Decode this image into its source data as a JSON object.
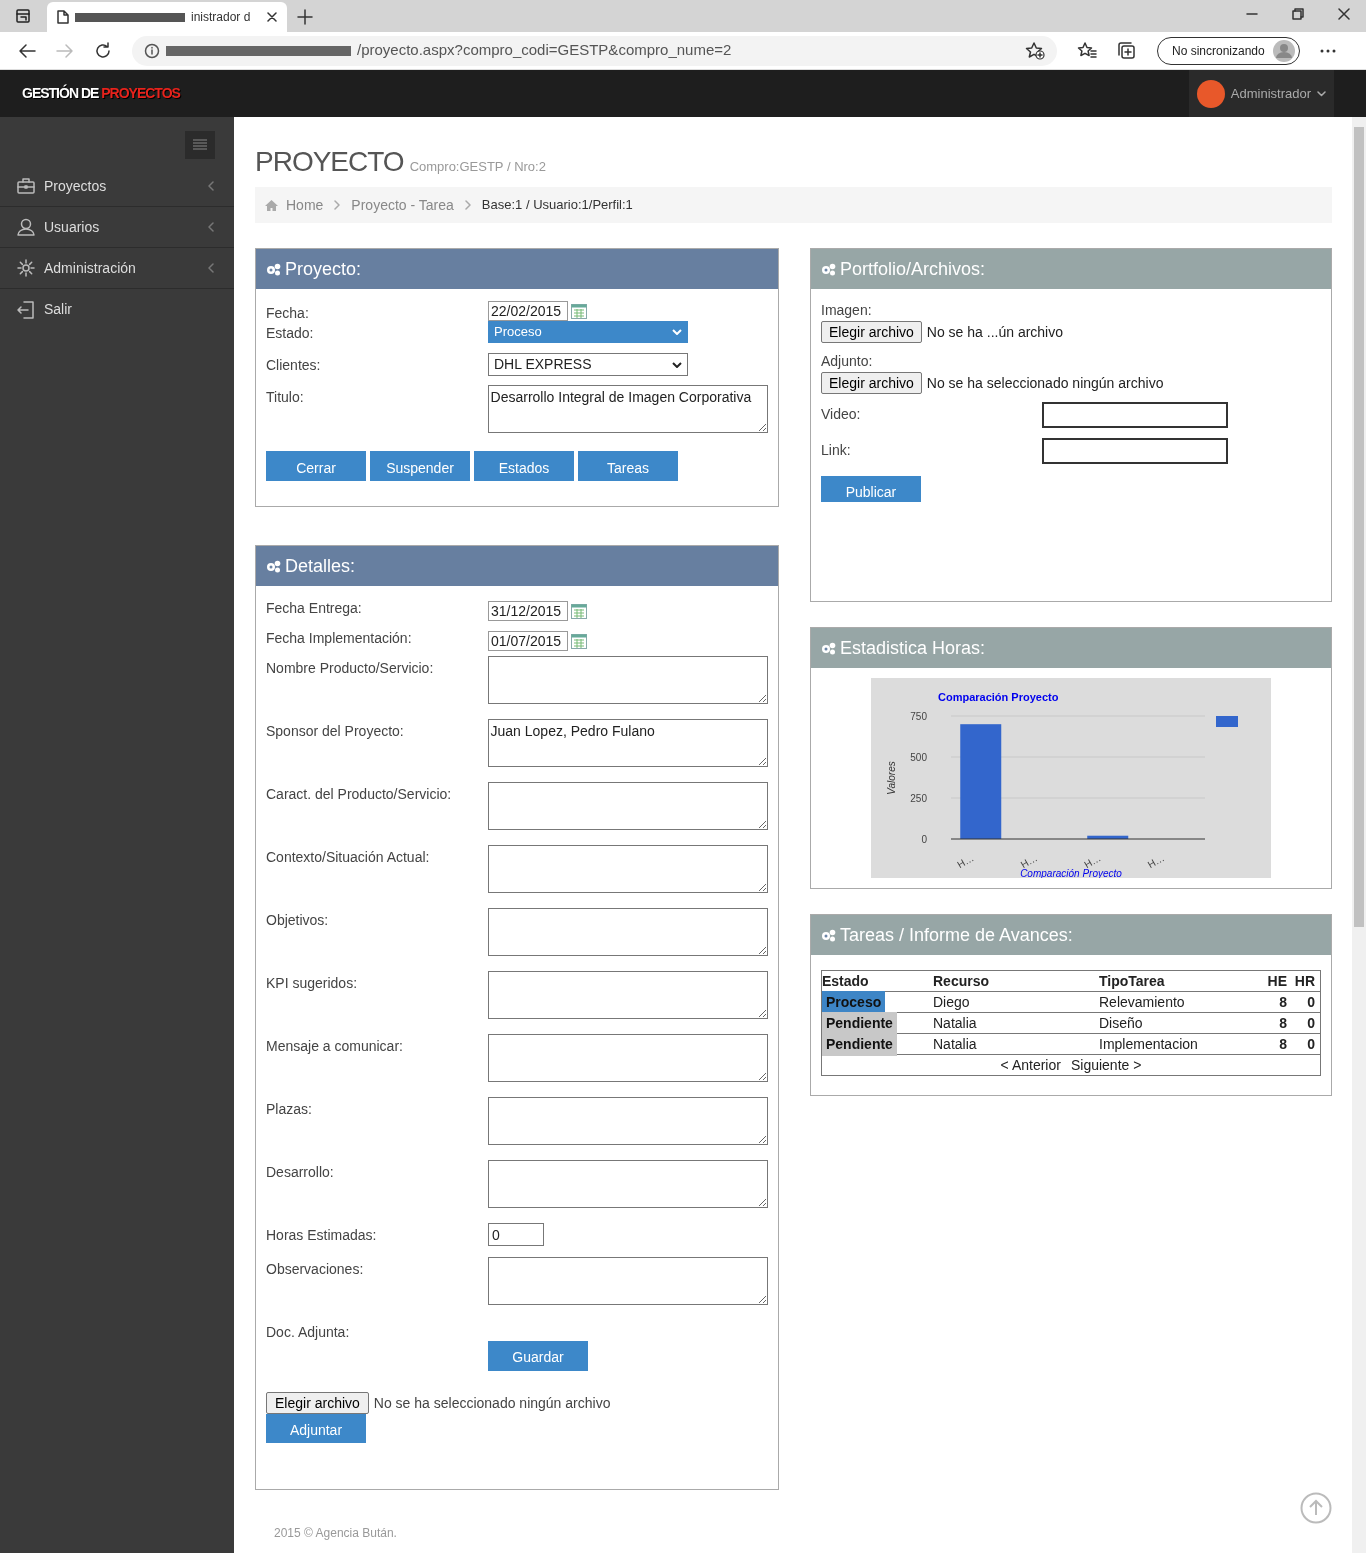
{
  "browser": {
    "tab_title": "inistrador d",
    "url": "/proyecto.aspx?compro_codi=GESTP&compro_nume=2",
    "sync_button": "No sincronizando"
  },
  "header": {
    "logo": {
      "part_1": "GESTIÓN DE",
      "part_2": "PROYECTOS"
    },
    "user": "Administrador"
  },
  "sidebar": {
    "items": [
      {
        "label": "Proyectos",
        "kind": "briefcase"
      },
      {
        "label": "Usuarios",
        "kind": "user"
      },
      {
        "label": "Administración",
        "kind": "gear"
      },
      {
        "label": "Salir",
        "kind": "exit"
      }
    ]
  },
  "page": {
    "title": "PROYECTO",
    "subtitle": "Compro:GESTP / Nro:2"
  },
  "breadcrumb": {
    "items": [
      "Home",
      "Proyecto - Tarea"
    ],
    "info": "Base:1 / Usuario:1/Perfil:1"
  },
  "proyecto": {
    "title": "Proyecto:",
    "fields": [
      {
        "label": "Fecha:",
        "kind": "date",
        "value": "22/02/2015"
      },
      {
        "label": "Estado:",
        "kind": "select",
        "value": "Proceso",
        "focused": true
      },
      {
        "label": "Clientes:",
        "kind": "select",
        "value": "DHL EXPRESS",
        "focused": false
      },
      {
        "label": "Titulo:",
        "kind": "textarea",
        "value": "Desarrollo Integral de Imagen Corporativa"
      }
    ],
    "buttons": [
      "Cerrar",
      "Suspender",
      "Estados",
      "Tareas"
    ]
  },
  "detalles": {
    "title": "Detalles:",
    "fields": [
      {
        "label": "Fecha Entrega:",
        "kind": "date",
        "value": "31/12/2015"
      },
      {
        "label": "Fecha Implementación:",
        "kind": "date",
        "value": "01/07/2015"
      },
      {
        "label": "Nombre Producto/Servicio:",
        "kind": "textarea"
      },
      {
        "label": "Sponsor del Proyecto:",
        "kind": "textarea",
        "value": "Juan Lopez, Pedro Fulano"
      },
      {
        "label": "Caract. del Producto/Servicio:",
        "kind": "textarea"
      },
      {
        "label": "Contexto/Situación Actual:",
        "kind": "textarea"
      },
      {
        "label": "Objetivos:",
        "kind": "textarea"
      },
      {
        "label": "KPI sugeridos:",
        "kind": "textarea"
      },
      {
        "label": "Mensaje a comunicar:",
        "kind": "textarea"
      },
      {
        "label": "Plazas:",
        "kind": "textarea"
      },
      {
        "label": "Desarrollo:",
        "kind": "textarea"
      },
      {
        "label": "Horas Estimadas:",
        "kind": "text",
        "value": "0"
      },
      {
        "label": "Observaciones:",
        "kind": "textarea"
      },
      {
        "label": "Doc. Adjunta:",
        "kind": "label"
      }
    ],
    "save_button": "Guardar",
    "file_button": "Elegir archivo",
    "file_status": "No se ha seleccionado ningún archivo",
    "attach_button": "Adjuntar"
  },
  "portfolio": {
    "title": "Portfolio/Archivos:",
    "files": [
      {
        "label": "Imagen:",
        "button": "Elegir archivo",
        "status": "No se ha ...ún archivo"
      },
      {
        "label": "Adjunto:",
        "button": "Elegir archivo",
        "status": "No se ha seleccionado ningún archivo"
      }
    ],
    "inputs": [
      "Video:",
      "Link:"
    ],
    "publish_button": "Publicar"
  },
  "estadistica": {
    "title": "Estadistica Horas:",
    "chart_data": {
      "type": "bar",
      "title": "Comparación Proyecto",
      "xlabel": "Comparación Proyecto",
      "ylabel": "Valores",
      "categories": [
        "H…",
        "H…",
        "H…",
        "H…"
      ],
      "series": [
        {
          "color": "#3366cc",
          "values": [
            700,
            0,
            20,
            0
          ]
        }
      ],
      "ylim": [
        0,
        750
      ],
      "yticks": [
        0,
        250,
        500,
        750
      ]
    }
  },
  "tareas": {
    "title": "Tareas / Informe de Avances:",
    "columns": [
      "Estado",
      "Recurso",
      "TipoTarea",
      "HE",
      "HR"
    ],
    "rows": [
      {
        "estado": "Proceso",
        "color": "#3d85c6",
        "recurso": "Diego",
        "tipo": "Relevamiento",
        "he": "8",
        "hr": "0"
      },
      {
        "estado": "Pendiente",
        "color": "#c8c8c8",
        "recurso": "Natalia",
        "tipo": "Diseño",
        "he": "8",
        "hr": "0"
      },
      {
        "estado": "Pendiente",
        "color": "#c8c8c8",
        "recurso": "Natalia",
        "tipo": "Implementacion",
        "he": "8",
        "hr": "0"
      }
    ],
    "pager": [
      "< Anterior",
      "Siguiente >"
    ]
  },
  "footer": "2015 © Agencia Bután."
}
